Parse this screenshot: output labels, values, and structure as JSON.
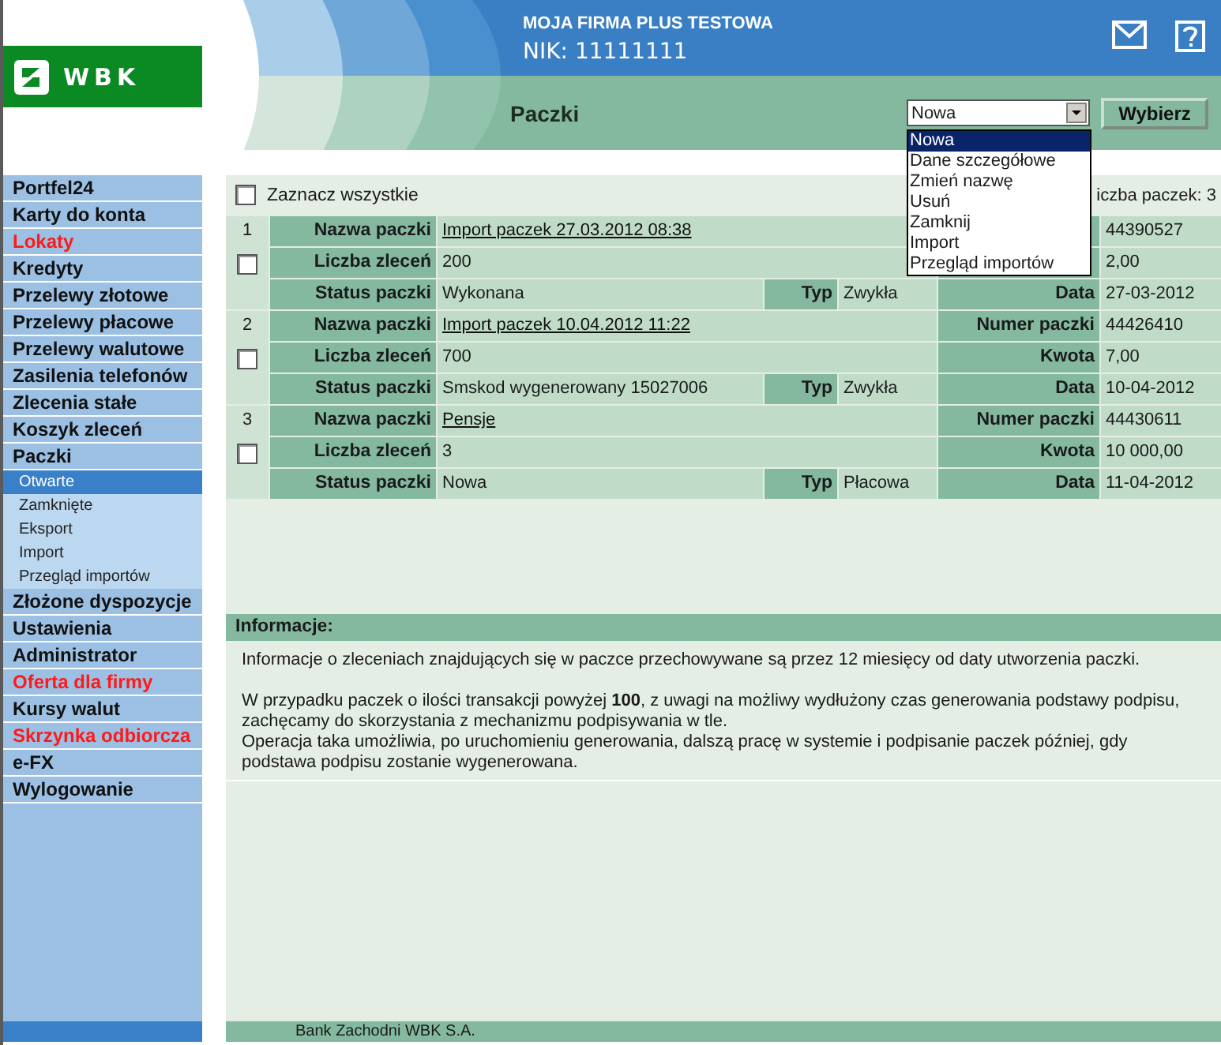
{
  "header": {
    "logo_text": "WBK",
    "company": "MOJA FIRMA PLUS TESTOWA",
    "nik": "NIK: 11111111",
    "page_title": "Paczki"
  },
  "action": {
    "value": "Nowa",
    "button": "Wybierz",
    "expanded": true,
    "options": [
      {
        "label": "Nowa",
        "selected": true
      },
      {
        "label": "Dane szczegółowe",
        "selected": false
      },
      {
        "label": "Zmień nazwę",
        "selected": false
      },
      {
        "label": "Usuń",
        "selected": false
      },
      {
        "label": "Zamknij",
        "selected": false
      },
      {
        "label": "Import",
        "selected": false
      },
      {
        "label": "Przegląd importów",
        "selected": false
      }
    ]
  },
  "sidebar": {
    "items": [
      {
        "label": "Portfel24",
        "kind": "standard"
      },
      {
        "label": "Karty do konta",
        "kind": "standard"
      },
      {
        "label": "Lokaty",
        "kind": "promo"
      },
      {
        "label": "Kredyty",
        "kind": "standard"
      },
      {
        "label": "Przelewy złotowe",
        "kind": "standard"
      },
      {
        "label": "Przelewy płacowe",
        "kind": "standard"
      },
      {
        "label": "Przelewy walutowe",
        "kind": "standard"
      },
      {
        "label": "Zasilenia telefonów",
        "kind": "standard"
      },
      {
        "label": "Zlecenia stałe",
        "kind": "standard"
      },
      {
        "label": "Koszyk zleceń",
        "kind": "standard"
      },
      {
        "label": "Paczki",
        "kind": "standard",
        "children": [
          {
            "label": "Otwarte",
            "selected": true
          },
          {
            "label": "Zamknięte",
            "selected": false
          },
          {
            "label": "Eksport",
            "selected": false
          },
          {
            "label": "Import",
            "selected": false
          },
          {
            "label": "Przegląd importów",
            "selected": false
          }
        ]
      },
      {
        "label": "Złożone dyspozycje",
        "kind": "standard"
      },
      {
        "label": "Ustawienia",
        "kind": "standard"
      },
      {
        "label": "Administrator",
        "kind": "standard"
      },
      {
        "label": "Oferta dla firmy",
        "kind": "promo"
      },
      {
        "label": "Kursy walut",
        "kind": "standard"
      },
      {
        "label": "Skrzynka odbiorcza",
        "kind": "promo"
      },
      {
        "label": "e-FX",
        "kind": "standard"
      },
      {
        "label": "Wylogowanie",
        "kind": "standard"
      }
    ]
  },
  "packages": {
    "select_all": {
      "label": "Zaznacz wszystkie",
      "checked": false
    },
    "count": "iczba paczek: 3",
    "rows": [
      {
        "number": "1",
        "checked": false,
        "name_label": "Nazwa paczki",
        "name": "Import paczek 27.03.2012 08:38",
        "count_label": "Liczba zleceń",
        "count": "200",
        "status_label": "Status paczki",
        "status": "Wykonana",
        "type_label": "Typ",
        "type": "Zwykła",
        "id": "44390527",
        "amount": "2,00",
        "date_label": "Data",
        "date": "27-03-2012"
      },
      {
        "number": "2",
        "checked": false,
        "name_label": "Nazwa paczki",
        "name": "Import paczek 10.04.2012 11:22",
        "count_label": "Liczba zleceń",
        "count": "700",
        "status_label": "Status paczki",
        "status": "Smskod wygenerowany 15027006",
        "type_label": "Typ",
        "type": "Zwykła",
        "id_label": "Numer paczki",
        "id": "44426410",
        "amount_label": "Kwota",
        "amount": "7,00",
        "date_label": "Data",
        "date": "10-04-2012"
      },
      {
        "number": "3",
        "checked": false,
        "name_label": "Nazwa paczki",
        "name": "Pensje",
        "count_label": "Liczba zleceń",
        "count": "3",
        "status_label": "Status paczki",
        "status": "Nowa",
        "type_label": "Typ",
        "type": "Płacowa",
        "id_label": "Numer paczki",
        "id": "44430611",
        "amount_label": "Kwota",
        "amount": "10 000,00",
        "date_label": "Data",
        "date": "11-04-2012"
      }
    ]
  },
  "info": {
    "title": "Informacje:",
    "paragraphs": [
      "Informacje o zleceniach znajdujących się w paczce przechowywane są przez 12 miesięcy od daty utworzenia paczki.",
      "W przypadku paczek o ilości transakcji powyżej **100**, z uwagi na możliwy wydłużony czas generowania podstawy podpisu, zachęcamy do skorzystania z mechanizmu podpisywania w tle.",
      "Operacja taka umożliwia, po uruchomieniu generowania, dalszą pracę w systemie i podpisanie paczek później, gdy podstawa podpisu zostanie wygenerowana."
    ]
  },
  "footer": "Bank Zachodni WBK S.A."
}
